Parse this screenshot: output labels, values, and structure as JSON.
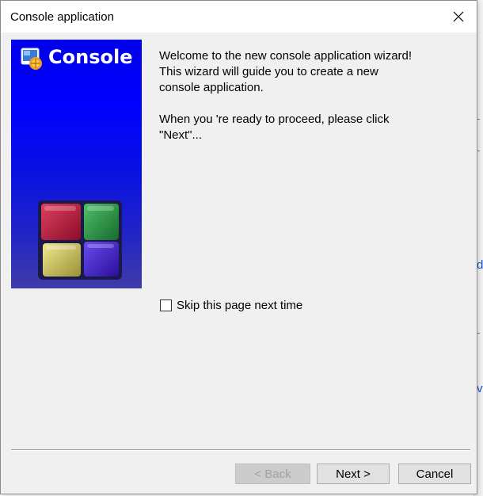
{
  "window": {
    "title": "Console application",
    "close_glyph": "×"
  },
  "banner": {
    "title": "Console",
    "logo_icon": "codeblocks-icon",
    "cubes_icon": "codeblocks-cubes-logo",
    "colors": {
      "top": "#0000e8",
      "bottom": "#3f3ca9",
      "cube_red": "#b3123a",
      "cube_green": "#1f8f3a",
      "cube_yellow": "#c9c15a",
      "cube_purple": "#3a16c2"
    }
  },
  "content": {
    "welcome_line1": "Welcome to the new console application wizard!",
    "welcome_line2": "This wizard will guide you to create a new",
    "welcome_line3": "console application.",
    "proceed_line1": "When you 're ready to proceed, please click",
    "proceed_line2": "\"Next\"..."
  },
  "skip": {
    "label": "Skip this page next time",
    "checked": false
  },
  "buttons": {
    "back": "< Back",
    "next": "Next >",
    "cancel": "Cancel"
  },
  "background_glyphs": [
    "d",
    "v"
  ]
}
